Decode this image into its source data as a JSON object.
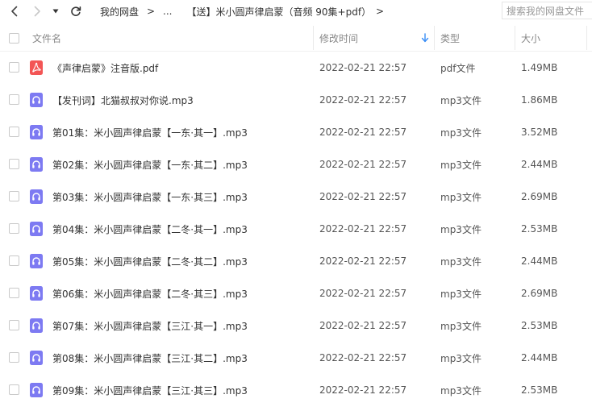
{
  "nav": {
    "back_icon": "chevron-left-icon",
    "forward_icon": "chevron-right-icon",
    "dropdown_icon": "caret-down-icon",
    "refresh_icon": "refresh-icon"
  },
  "breadcrumb": {
    "root": "我的网盘",
    "sep1": ">",
    "ellipsis": "...",
    "sep2": ">",
    "current": "【送】米小圆声律启蒙（音频 90集+pdf）",
    "sep3": ">"
  },
  "search": {
    "placeholder": "搜索我的网盘文件"
  },
  "columns": {
    "name": "文件名",
    "modified": "修改时间",
    "type": "类型",
    "size": "大小"
  },
  "colors": {
    "pdf_icon": "#f35555",
    "audio_icon": "#7d7af2",
    "accent": "#3a8ef6"
  },
  "files": [
    {
      "name": "《声律启蒙》注音版.pdf",
      "modified": "2022-02-21 22:57",
      "type": "pdf文件",
      "size": "1.49MB",
      "icon": "pdf-file-icon"
    },
    {
      "name": "【发刊词】北猫叔叔对你说.mp3",
      "modified": "2022-02-21 22:57",
      "type": "mp3文件",
      "size": "1.86MB",
      "icon": "audio-file-icon"
    },
    {
      "name": "第01集：米小圆声律启蒙【一东·其一】.mp3",
      "modified": "2022-02-21 22:57",
      "type": "mp3文件",
      "size": "3.52MB",
      "icon": "audio-file-icon"
    },
    {
      "name": "第02集：米小圆声律启蒙【一东·其二】.mp3",
      "modified": "2022-02-21 22:57",
      "type": "mp3文件",
      "size": "2.44MB",
      "icon": "audio-file-icon"
    },
    {
      "name": "第03集：米小圆声律启蒙【一东·其三】.mp3",
      "modified": "2022-02-21 22:57",
      "type": "mp3文件",
      "size": "2.69MB",
      "icon": "audio-file-icon"
    },
    {
      "name": "第04集：米小圆声律启蒙【二冬·其一】.mp3",
      "modified": "2022-02-21 22:57",
      "type": "mp3文件",
      "size": "2.53MB",
      "icon": "audio-file-icon"
    },
    {
      "name": "第05集：米小圆声律启蒙【二冬·其二】.mp3",
      "modified": "2022-02-21 22:57",
      "type": "mp3文件",
      "size": "2.44MB",
      "icon": "audio-file-icon"
    },
    {
      "name": "第06集：米小圆声律启蒙【二冬·其三】.mp3",
      "modified": "2022-02-21 22:57",
      "type": "mp3文件",
      "size": "2.69MB",
      "icon": "audio-file-icon"
    },
    {
      "name": "第07集：米小圆声律启蒙【三江·其一】.mp3",
      "modified": "2022-02-21 22:57",
      "type": "mp3文件",
      "size": "2.53MB",
      "icon": "audio-file-icon"
    },
    {
      "name": "第08集：米小圆声律启蒙【三江·其二】.mp3",
      "modified": "2022-02-21 22:57",
      "type": "mp3文件",
      "size": "2.44MB",
      "icon": "audio-file-icon"
    },
    {
      "name": "第09集：米小圆声律启蒙【三江·其三】.mp3",
      "modified": "2022-02-21 22:57",
      "type": "mp3文件",
      "size": "2.53MB",
      "icon": "audio-file-icon"
    }
  ]
}
